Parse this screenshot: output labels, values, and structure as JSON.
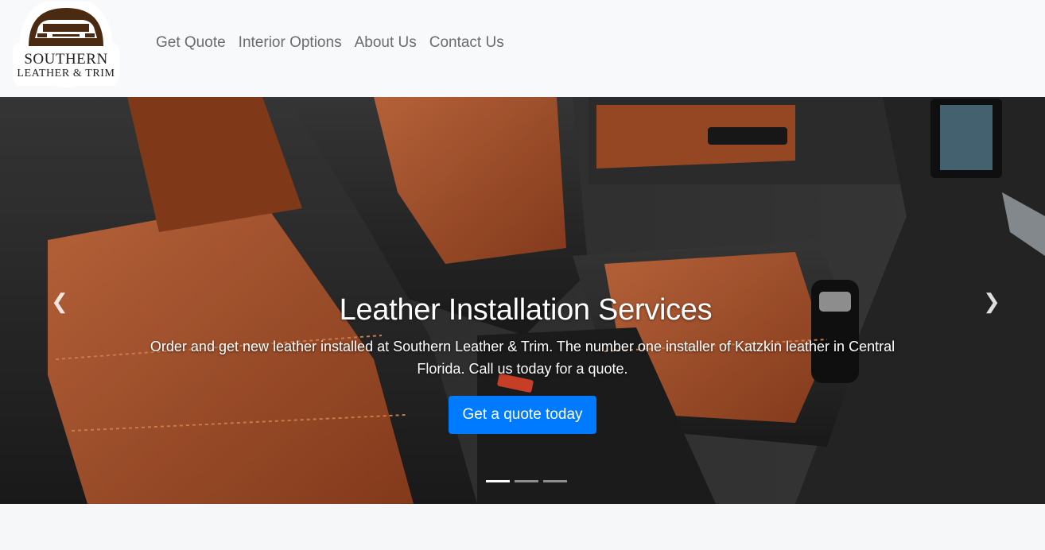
{
  "brand": {
    "line1": "SOUTHERN",
    "line2": "LEATHER & TRIM"
  },
  "nav": {
    "items": [
      {
        "label": "Get Quote"
      },
      {
        "label": "Interior Options"
      },
      {
        "label": "About Us"
      },
      {
        "label": "Contact Us"
      }
    ]
  },
  "hero": {
    "title": "Leather Installation Services",
    "text": "Order and get new leather installed at Southern Leather & Trim. The number one installer of Katzkin leather in Central Florida. Call us today for a quote.",
    "cta_label": "Get a quote today",
    "slide_count": 3,
    "active_slide": 1
  },
  "icons": {
    "prev": "chevron-left-icon",
    "next": "chevron-right-icon"
  },
  "colors": {
    "accent": "#007bff",
    "leather": "#b55a32",
    "logo_brown": "#4a2a10"
  }
}
